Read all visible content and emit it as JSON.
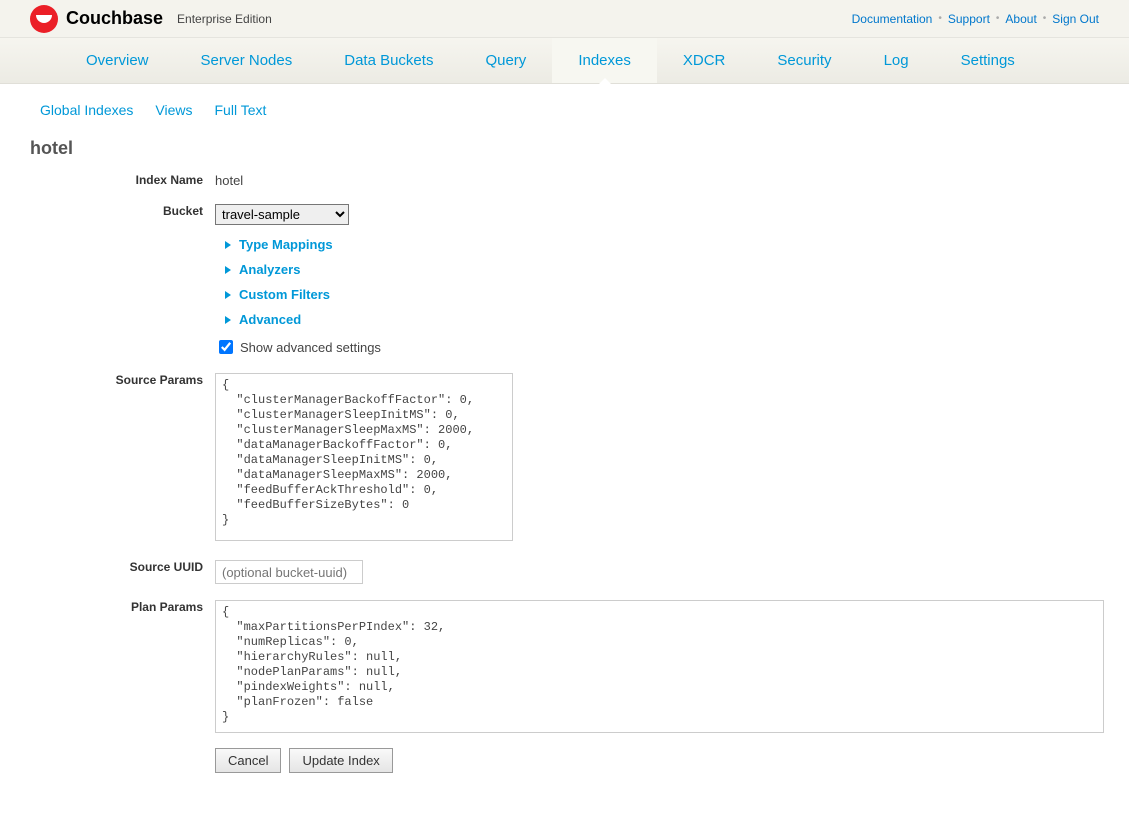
{
  "brand": "Couchbase",
  "edition": "Enterprise Edition",
  "top_links": {
    "doc": "Documentation",
    "support": "Support",
    "about": "About",
    "signout": "Sign Out"
  },
  "nav": {
    "overview": "Overview",
    "server_nodes": "Server Nodes",
    "data_buckets": "Data Buckets",
    "query": "Query",
    "indexes": "Indexes",
    "xdcr": "XDCR",
    "security": "Security",
    "log": "Log",
    "settings": "Settings"
  },
  "subnav": {
    "global_indexes": "Global Indexes",
    "views": "Views",
    "full_text": "Full Text"
  },
  "page_title": "hotel",
  "labels": {
    "index_name": "Index Name",
    "bucket": "Bucket",
    "source_params": "Source Params",
    "source_uuid": "Source UUID",
    "plan_params": "Plan Params",
    "show_advanced": "Show advanced settings"
  },
  "values": {
    "index_name": "hotel",
    "bucket": "travel-sample",
    "source_uuid_placeholder": "(optional bucket-uuid)",
    "source_params": "{\n  \"clusterManagerBackoffFactor\": 0,\n  \"clusterManagerSleepInitMS\": 0,\n  \"clusterManagerSleepMaxMS\": 2000,\n  \"dataManagerBackoffFactor\": 0,\n  \"dataManagerSleepInitMS\": 0,\n  \"dataManagerSleepMaxMS\": 2000,\n  \"feedBufferAckThreshold\": 0,\n  \"feedBufferSizeBytes\": 0\n}",
    "plan_params": "{\n  \"maxPartitionsPerPIndex\": 32,\n  \"numReplicas\": 0,\n  \"hierarchyRules\": null,\n  \"nodePlanParams\": null,\n  \"pindexWeights\": null,\n  \"planFrozen\": false\n}"
  },
  "expand": {
    "type_mappings": "Type Mappings",
    "analyzers": "Analyzers",
    "custom_filters": "Custom Filters",
    "advanced": "Advanced"
  },
  "buttons": {
    "cancel": "Cancel",
    "update": "Update Index"
  }
}
